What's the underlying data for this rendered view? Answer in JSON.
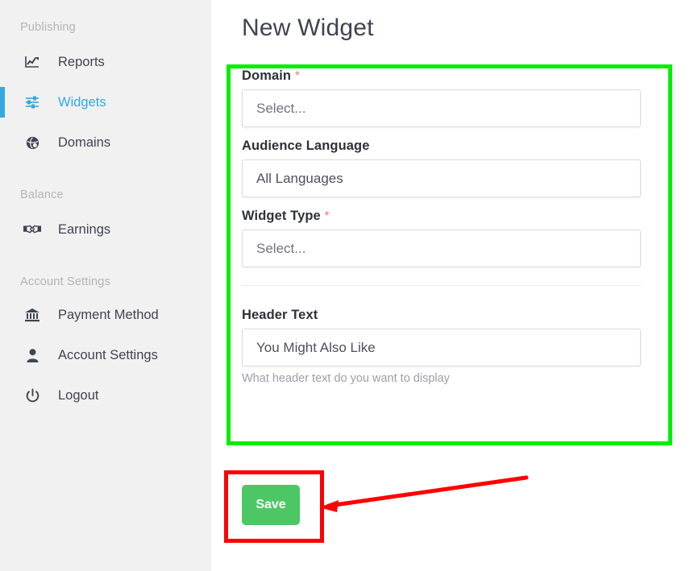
{
  "sidebar": {
    "sections": [
      {
        "title": "Publishing",
        "items": [
          {
            "label": "Reports",
            "icon": "line-chart-icon",
            "active": false
          },
          {
            "label": "Widgets",
            "icon": "sliders-icon",
            "active": true
          },
          {
            "label": "Domains",
            "icon": "globe-icon",
            "active": false
          }
        ]
      },
      {
        "title": "Balance",
        "items": [
          {
            "label": "Earnings",
            "icon": "handshake-icon",
            "active": false
          }
        ]
      },
      {
        "title": "Account Settings",
        "items": [
          {
            "label": "Payment Method",
            "icon": "bank-icon",
            "active": false
          },
          {
            "label": "Account Settings",
            "icon": "user-icon",
            "active": false
          },
          {
            "label": "Logout",
            "icon": "power-icon",
            "active": false
          }
        ]
      }
    ]
  },
  "main": {
    "page_title": "New Widget",
    "form": {
      "fields": [
        {
          "label": "Domain",
          "required": true,
          "required_marker": "*",
          "value": "Select...",
          "placeholder": "Select...",
          "is_placeholder": true,
          "help": ""
        },
        {
          "label": "Audience Language",
          "required": false,
          "required_marker": "",
          "value": "All Languages",
          "placeholder": "All Languages",
          "is_placeholder": false,
          "help": ""
        },
        {
          "label": "Widget Type",
          "required": true,
          "required_marker": "*",
          "value": "Select...",
          "placeholder": "Select...",
          "is_placeholder": true,
          "help": ""
        },
        {
          "label": "Header Text",
          "required": false,
          "required_marker": "",
          "value": "You Might Also Like",
          "placeholder": "You Might Also Like",
          "is_placeholder": false,
          "help": "What header text do you want to display"
        }
      ]
    },
    "save_label": "Save"
  },
  "annotations": {
    "green_box_color": "#00ee00",
    "red_box_color": "#fe0000",
    "arrow_color": "#fe0000"
  },
  "colors": {
    "accent_blue": "#35a8e0",
    "save_green": "#4cc764",
    "sidebar_bg": "#f1f1f1",
    "required_star": "#ef7b7b"
  }
}
